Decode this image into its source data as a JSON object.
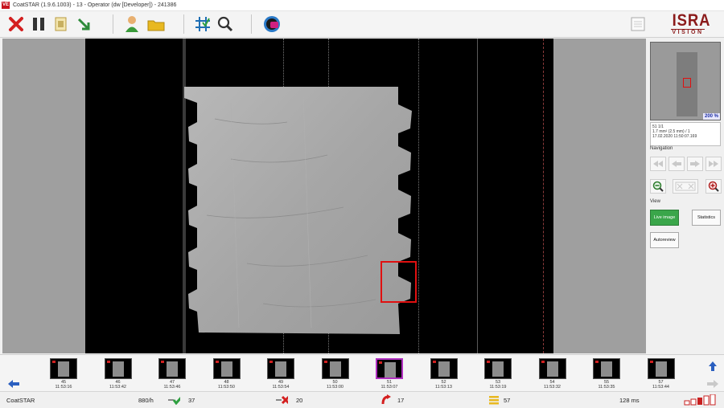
{
  "window": {
    "badge": "VE",
    "title": "CoatSTAR (1.9.6.1003) - 13 - Operator (dw [Developer]) - 241386"
  },
  "toolbar": {
    "buttons": [
      {
        "name": "close-icon",
        "color": "#d42020"
      },
      {
        "name": "pause-icon",
        "color": "#333333"
      },
      {
        "name": "document-icon",
        "color": "#c8b060"
      },
      {
        "name": "export-icon",
        "color": "#2e8b3a"
      },
      {
        "name": "user-icon",
        "color": "#3a9a3a"
      },
      {
        "name": "folder-icon",
        "color": "#e8b820"
      },
      {
        "name": "grid-icon",
        "color": "#1e6eb4"
      },
      {
        "name": "zoom-icon",
        "color": "#333333"
      },
      {
        "name": "globe-icon",
        "color": "#d02080"
      }
    ],
    "right_button": "panel-icon"
  },
  "logo": {
    "brand": "ISRA",
    "sub": "VISION",
    "color": "#8b1a1a"
  },
  "right_panel": {
    "minimap_zoom": "200 %",
    "info_lines": [
      "51 1/1",
      "1.7 mm² (2.5 mm) / 1",
      "17.02.2020 11:50:07.169"
    ],
    "navigation_label": "Navigation",
    "view_label": "View",
    "live_image_label": "Live image",
    "statistics_label": "Statistics",
    "autoreview_label": "Autoreview"
  },
  "thumbnails": [
    {
      "id": "45",
      "time": "11:53:16"
    },
    {
      "id": "46",
      "time": "11:53:42"
    },
    {
      "id": "47",
      "time": "11:53:46"
    },
    {
      "id": "48",
      "time": "11:53:50"
    },
    {
      "id": "49",
      "time": "11:53:54"
    },
    {
      "id": "50",
      "time": "11:53:00"
    },
    {
      "id": "51",
      "time": "11:53:07",
      "selected": true
    },
    {
      "id": "52",
      "time": "11:53:13"
    },
    {
      "id": "53",
      "time": "11:53:19"
    },
    {
      "id": "54",
      "time": "11:53:32"
    },
    {
      "id": "55",
      "time": "11:53:35"
    },
    {
      "id": "57",
      "time": "11:53:44"
    }
  ],
  "status": {
    "app_name": "CoatSTAR",
    "rate": "880/h",
    "ok_count": "37",
    "nok_count": "20",
    "rework_count": "17",
    "total_count": "57",
    "cycle_time": "128 ms"
  }
}
